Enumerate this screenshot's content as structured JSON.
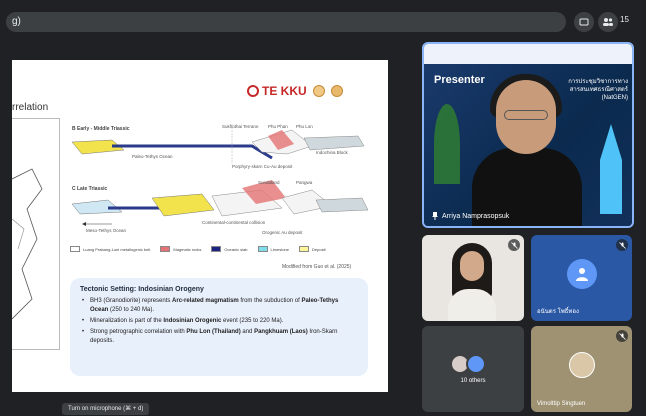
{
  "meeting": {
    "title": "g)",
    "participant_count": "15"
  },
  "slide": {
    "heading": "rrelation",
    "logo_tekku": "TE KKU",
    "diagram": {
      "panel_b_title": "B  Early - Middle Triassic",
      "panel_c_title": "C  Late Triassic",
      "paleo_ocean": "Paleo-Tethys Ocean",
      "meso_ocean": "Meso-Tethys Ocean",
      "label_sukhothai": "Sukhothai Terrane",
      "label_phuphan": "Phu Phan",
      "label_phulon": "Phu Lon",
      "label_indochina": "Indochina Block",
      "label_porphyry": "Porphyry-skarn Cu-Au deposit",
      "label_orogenic": "Orogenic Au deposit",
      "label_sundaland": "Sundaland",
      "label_pangwa": "Pangwa",
      "label_continental": "Continental-continental collision"
    },
    "legend": [
      {
        "label": "Luang Prabang-Loei metallogenic belt",
        "color": "#ffffff"
      },
      {
        "label": "Magmatic rocks",
        "color": "#e57373"
      },
      {
        "label": "Oceanic slab",
        "color": "#1a237e"
      },
      {
        "label": "Limestone",
        "color": "#80deea"
      },
      {
        "label": "Deposit",
        "color": "#fff59d"
      }
    ],
    "modified": "Modified from Guo et al. (2025)",
    "info": {
      "title": "Tectonic Setting: Indosinian Orogeny",
      "bullets": [
        {
          "pre": "BH3 (Granodiorite) represents ",
          "bold1": "Arc-related magmatism",
          "mid": " from the subduction of ",
          "bold2": "Paleo-Tethys Ocean",
          "post": " (250 to 240 Ma)."
        },
        {
          "pre": "Mineralization is part of the ",
          "bold1": "Indosinian Orogenic",
          "mid": " event (235 to 220 Ma).",
          "bold2": "",
          "post": ""
        },
        {
          "pre": "Strong petrographic correlation with ",
          "bold1": "Phu Lon (Thailand)",
          "mid": " and ",
          "bold2": "Pangkhuam (Laos)",
          "post": " Iron-Skarn deposits."
        }
      ]
    }
  },
  "presenter": {
    "label": "Presenter",
    "conference_text": "การประชุมวิชาการทางสารสนเทศธรณีศาสตร์ (NatGEN)",
    "name": "Arriya Namprasopsuk"
  },
  "tiles": [
    {
      "name": "",
      "type": "video"
    },
    {
      "name": "อนันตร โพธิ์ทอง",
      "type": "avatar"
    },
    {
      "name": "10 others",
      "type": "group"
    },
    {
      "name": "Vimolttip Singtuen",
      "type": "avatar-photo"
    }
  ],
  "tooltip": "Turn on microphone (⌘ + d)",
  "colors": {
    "background": "#202124",
    "accent": "#8ab4f8",
    "avatar_blue": "#5e97f6"
  }
}
